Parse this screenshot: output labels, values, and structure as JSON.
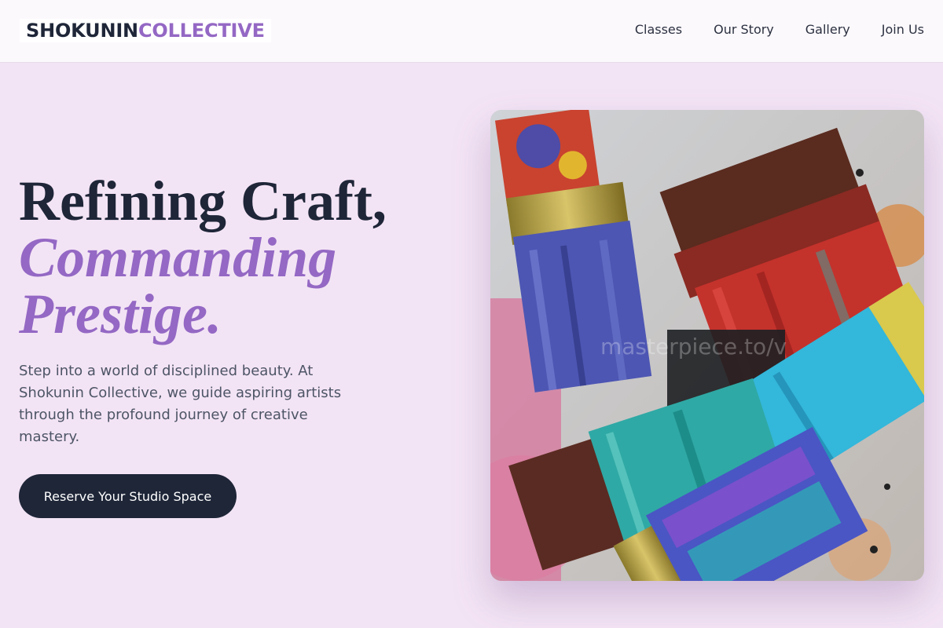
{
  "header": {
    "logo_part1": "SHOKUNIN",
    "logo_part2": "COLLECTIVE",
    "nav": [
      {
        "label": "Classes"
      },
      {
        "label": "Our Story"
      },
      {
        "label": "Gallery"
      },
      {
        "label": "Join Us"
      }
    ]
  },
  "hero": {
    "title_line1": "Refining Craft,",
    "title_line2": "Commanding",
    "title_line3": "Prestige.",
    "description": "Step into a world of disciplined beauty. At Shokunin Collective, we guide aspiring artists through the profound journey of creative mastery.",
    "cta_label": "Reserve Your Studio Space",
    "image_watermark": "masterpiece.to/v",
    "image_subject": "paint-brushes-image"
  },
  "colors": {
    "background": "#f3e4f5",
    "navy": "#1e2638",
    "accent_purple": "#9468c4"
  }
}
